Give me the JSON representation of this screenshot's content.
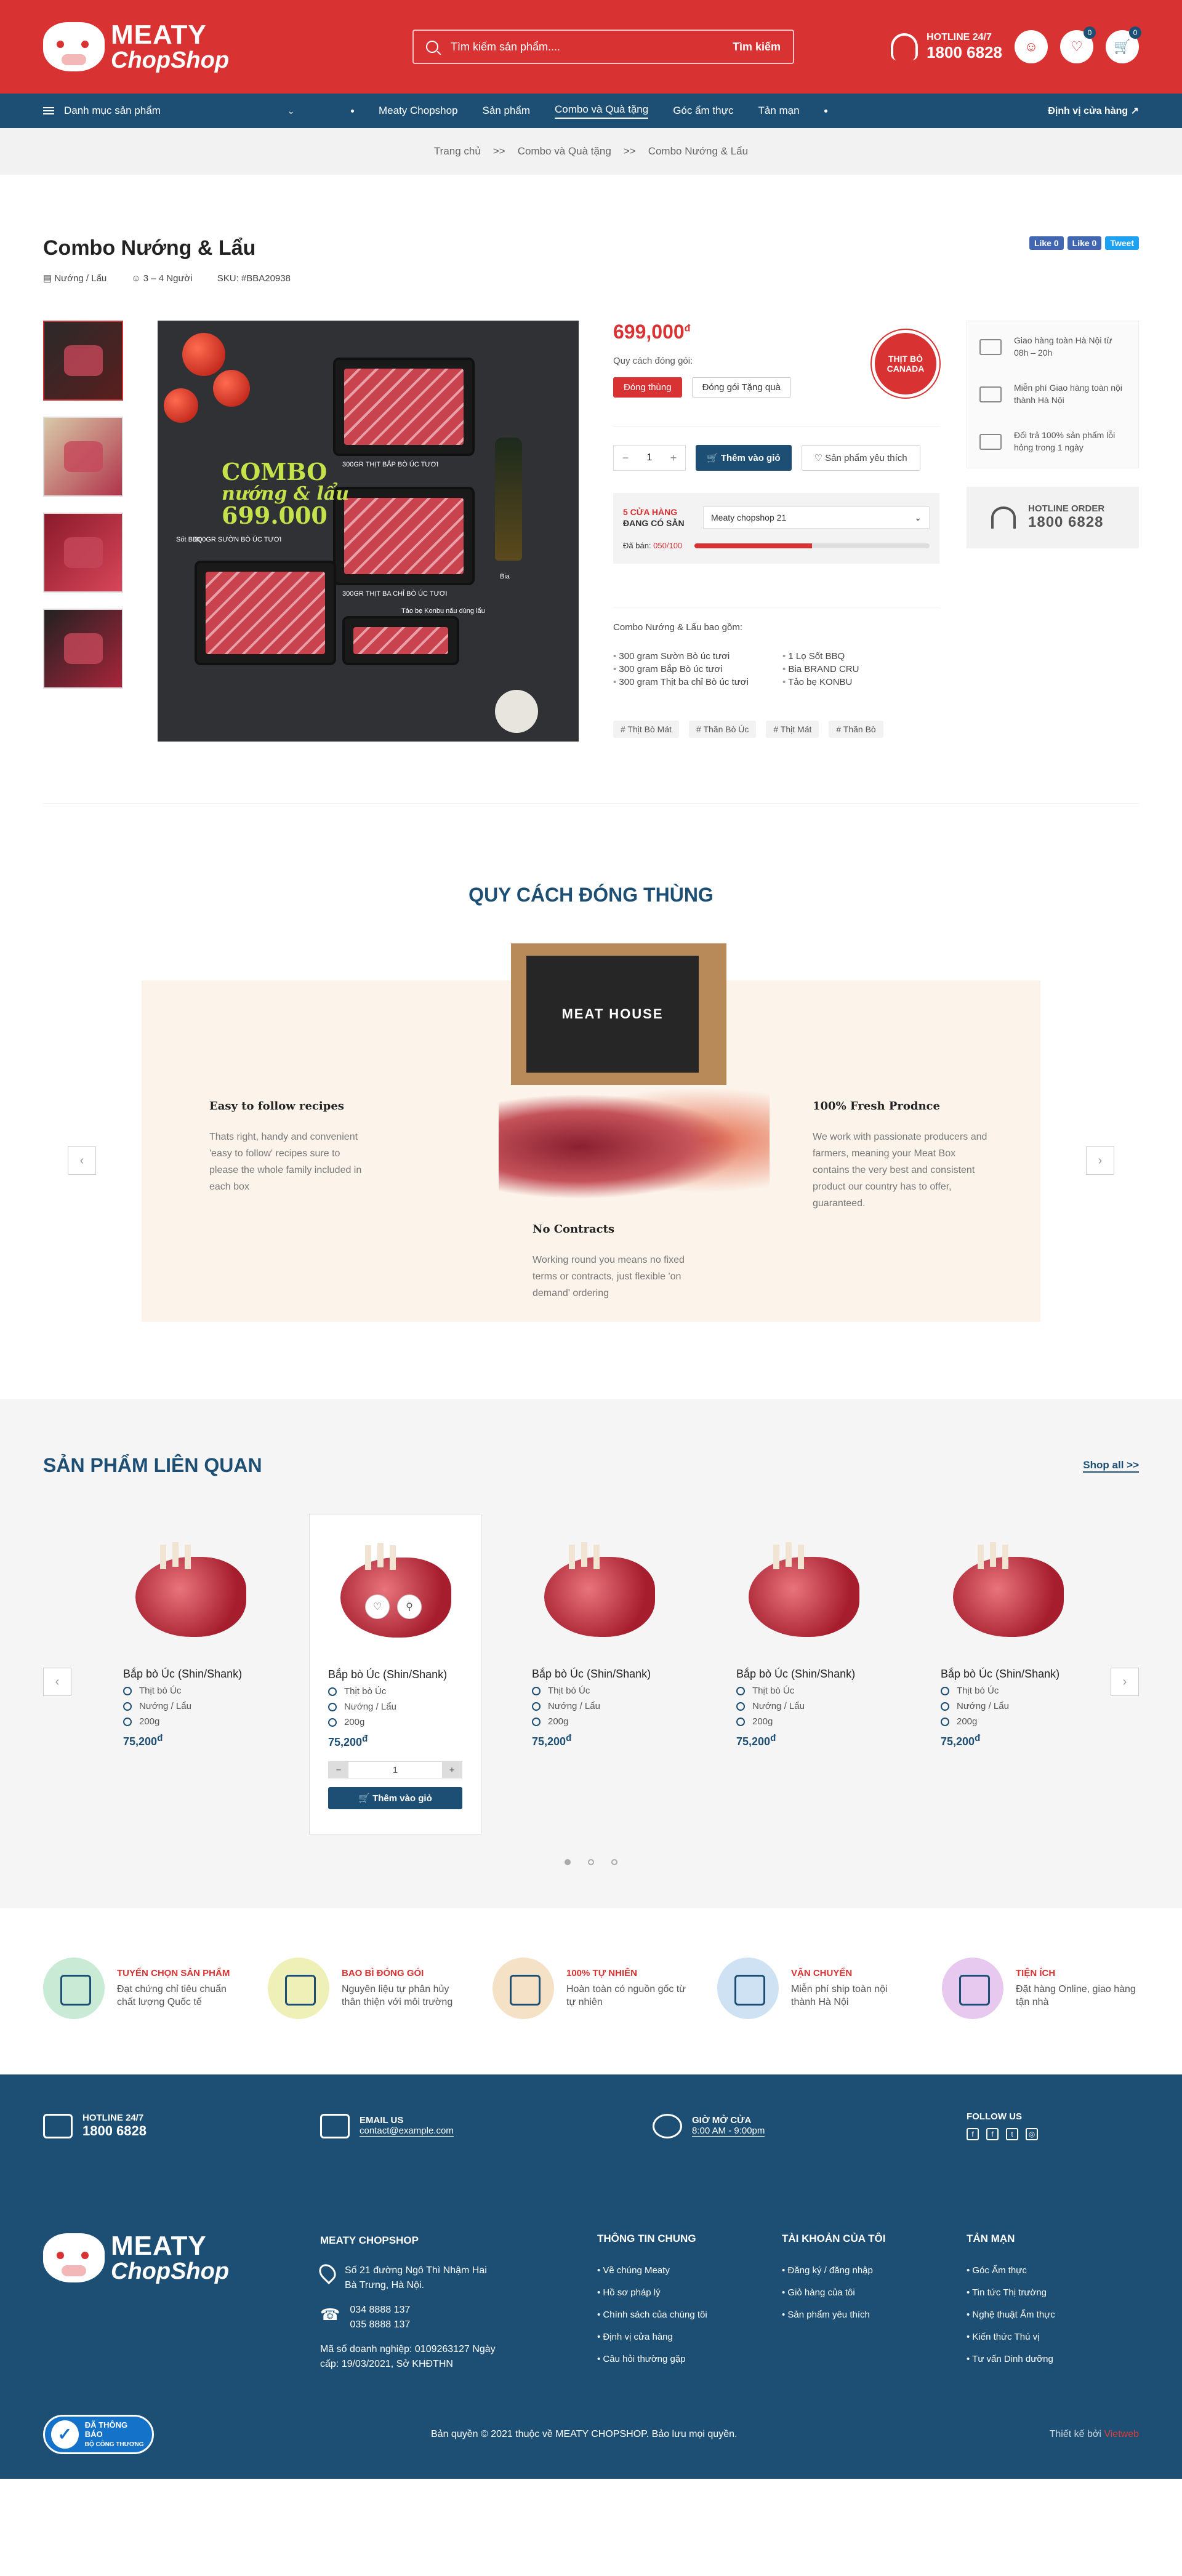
{
  "header": {
    "logo_line1": "MEATY",
    "logo_line2": "ChopShop",
    "search_placeholder": "Tìm kiếm sản phẩm....",
    "search_button": "Tìm kiếm",
    "hotline_label": "HOTLINE 24/7",
    "hotline_number": "1800 6828",
    "wishlist_count": "0",
    "cart_count": "0"
  },
  "nav": {
    "category_menu": "Danh mục sản phẩm",
    "items": [
      "Meaty Chopshop",
      "Sản phẩm",
      "Combo và Quà tặng",
      "Góc ẩm thực",
      "Tản mạn"
    ],
    "active_index": 2,
    "right_link": "Định vị cửa hàng"
  },
  "breadcrumb": {
    "items": [
      "Trang chủ",
      "Combo và Quà tặng",
      "Combo Nướng & Lẩu"
    ],
    "separator": ">>"
  },
  "product": {
    "title": "Combo Nướng & Lẩu",
    "category": "Nướng / Lẩu",
    "servings": "3 – 4 Người",
    "sku": "SKU: #BBA20938",
    "share": [
      "Like 0",
      "Like 0",
      "Tweet"
    ],
    "image_combo_line1": "COMBO",
    "image_combo_line2": "nướng & lẩu",
    "image_combo_price": "699.000",
    "image_labels": [
      "300GR THỊT BẮP BÒ ÚC TƯƠI",
      "300GR SƯỜN BÒ ÚC TƯƠI",
      "300GR THỊT BA CHỈ BÒ ÚC TƯƠI",
      "Sốt BBQ",
      "Bia",
      "Tảo bẹ Konbu nấu dùng lẩu"
    ],
    "price": "699,000",
    "currency": "đ",
    "pack_label": "Quy cách đóng gói:",
    "pack_options": [
      "Đóng thùng",
      "Đóng gói Tặng quà"
    ],
    "badge_text": "THỊT BÒ CANADA",
    "qty_minus": "−",
    "qty_value": "1",
    "qty_plus": "+",
    "add_to_cart": "Thêm vào giỏ",
    "wishlist": "Sản phẩm yêu thích",
    "stock_count": "5 CỬA HÀNG",
    "stock_label": "ĐANG CÓ SẴN",
    "store_select": "Meaty chopshop 21",
    "sold_label": "Đã bán:",
    "sold_value": "050/100",
    "sold_percent": 50,
    "includes_title": "Combo Nướng & Lẩu bao gồm:",
    "includes": [
      "300 gram Sườn Bò úc tươi",
      "1 Lọ Sốt BBQ",
      "300 gram Bắp Bò úc tươi",
      "Bia BRAND CRU",
      "300 gram Thịt ba chỉ Bò úc tươi",
      "Tảo bẹ KONBU"
    ],
    "tags": [
      "# Thịt Bò Mát",
      "# Thăn Bò Úc",
      "# Thịt Mát",
      "# Thăn Bò"
    ]
  },
  "services": [
    "Giao hàng toàn Hà Nội từ 08h – 20h",
    "Miễn phí Giao hàng toàn nội thành Hà Nội",
    "Đổi trả 100% sản phẩm lỗi hỏng trong 1 ngày"
  ],
  "hotline_order": {
    "label": "HOTLINE ORDER",
    "number": "1800 6828"
  },
  "packing": {
    "title": "QUY CÁCH ĐÓNG THÙNG",
    "box_label": "MEAT HOUSE",
    "steps": [
      {
        "title": "Easy to follow recipes",
        "text": "Thats right, handy and convenient 'easy to follow' recipes sure to please the whole family included in each box"
      },
      {
        "title": "No Contracts",
        "text": "Working round you means no fixed terms or contracts, just flexible 'on demand' ordering"
      },
      {
        "title": "100% Fresh Prodnce",
        "text": "We work with passionate producers and farmers, meaning your Meat Box contains the very best and consistent product our country has to offer, guaranteed."
      }
    ]
  },
  "related": {
    "title": "SẢN PHẨM LIÊN QUAN",
    "shop_all": "Shop all >>",
    "products": [
      {
        "name": "Bắp bò Úc (Shin/Shank)",
        "type": "Thịt bò Úc",
        "cat": "Nướng / Lẩu",
        "weight": "200g",
        "price": "75,200"
      },
      {
        "name": "Bắp bò Úc (Shin/Shank)",
        "type": "Thịt bò Úc",
        "cat": "Nướng / Lẩu",
        "weight": "200g",
        "price": "75,200"
      },
      {
        "name": "Bắp bò Úc (Shin/Shank)",
        "type": "Thịt bò Úc",
        "cat": "Nướng / Lẩu",
        "weight": "200g",
        "price": "75,200"
      },
      {
        "name": "Bắp bò Úc (Shin/Shank)",
        "type": "Thịt bò Úc",
        "cat": "Nướng / Lẩu",
        "weight": "200g",
        "price": "75,200"
      },
      {
        "name": "Bắp bò Úc (Shin/Shank)",
        "type": "Thịt bò Úc",
        "cat": "Nướng / Lẩu",
        "weight": "200g",
        "price": "75,200"
      }
    ],
    "card_qty": "1",
    "card_add": "Thêm vào giỏ"
  },
  "features": [
    {
      "title": "TUYỂN CHỌN SẢN PHẨM",
      "text": "Đạt chứng chỉ tiêu chuẩn chất lượng Quốc tế",
      "color": "#c9ead4"
    },
    {
      "title": "BAO BÌ ĐÓNG GÓI",
      "text": "Nguyên liệu tự phân hủy thân thiện với môi trường",
      "color": "#eef0b8"
    },
    {
      "title": "100% TỰ NHIÊN",
      "text": "Hoàn toàn có nguồn gốc từ tự nhiên",
      "color": "#f4e1c6"
    },
    {
      "title": "VẬN CHUYỂN",
      "text": "Miễn phí ship toàn nội thành Hà Nội",
      "color": "#cfe2f3"
    },
    {
      "title": "TIỆN ÍCH",
      "text": "Đặt hàng Online, giao hàng tận nhà",
      "color": "#e7c9ef"
    }
  ],
  "footer": {
    "hotline_label": "HOTLINE 24/7",
    "hotline_number": "1800 6828",
    "email_label": "EMAIL US",
    "email": "contact@example.com",
    "hours_label": "GIỜ MỞ CỬA",
    "hours": "8:00 AM - 9:00pm",
    "follow": "FOLLOW US",
    "company": "MEATY CHOPSHOP",
    "address": "Số 21 đường Ngô Thì Nhậm Hai Bà Trưng, Hà Nội.",
    "phone1": "034 8888 137",
    "phone2": "035 8888 137",
    "license": "Mã số doanh nghiệp: 0109263127 Ngày cấp: 19/03/2021, Sở KHĐTHN",
    "cols": [
      {
        "title": "THÔNG TIN CHUNG",
        "items": [
          "Về chúng Meaty",
          "Hồ sơ pháp lý",
          "Chính sách của chúng tôi",
          "Định vị cửa hàng",
          "Câu hỏi thường gặp"
        ]
      },
      {
        "title": "TÀI KHOẢN CỦA TÔI",
        "items": [
          "Đăng ký / đăng nhập",
          "Giỏ hàng của tôi",
          "Sản phẩm yêu thích"
        ]
      },
      {
        "title": "TẢN MẠN",
        "items": [
          "Góc Ẩm thực",
          "Tin tức Thị trường",
          "Nghệ thuật Ẩm thực",
          "Kiến thức Thú vị",
          "Tư vấn Dinh dưỡng"
        ]
      }
    ],
    "bct_line1": "ĐÃ THÔNG BÁO",
    "bct_line2": "BỘ CÔNG THƯƠNG",
    "copyright": "Bản quyền © 2021 thuộc về MEATY CHOPSHOP. Bảo lưu mọi quyền.",
    "design_label": "Thiết kế bởi",
    "design_by": "Vietweb"
  }
}
